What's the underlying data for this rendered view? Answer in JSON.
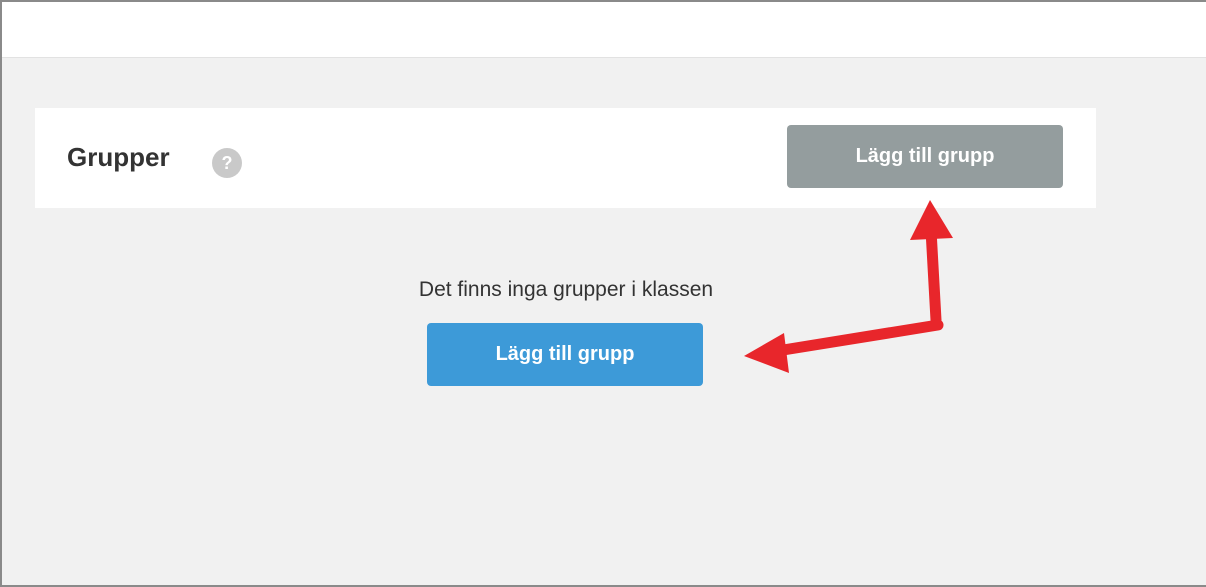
{
  "groups": {
    "title": "Grupper",
    "help_icon_glyph": "?",
    "add_group_label": "Lägg till grupp"
  },
  "empty_state": {
    "message": "Det finns inga grupper i klassen",
    "add_group_label": "Lägg till grupp"
  },
  "colors": {
    "header_button": "#949d9e",
    "primary_button": "#3d9ad8",
    "annotation_arrow": "#e8262b",
    "background": "#f1f1f1"
  },
  "icons": {
    "help": "help-icon",
    "arrows": "annotation-arrow-icon"
  }
}
